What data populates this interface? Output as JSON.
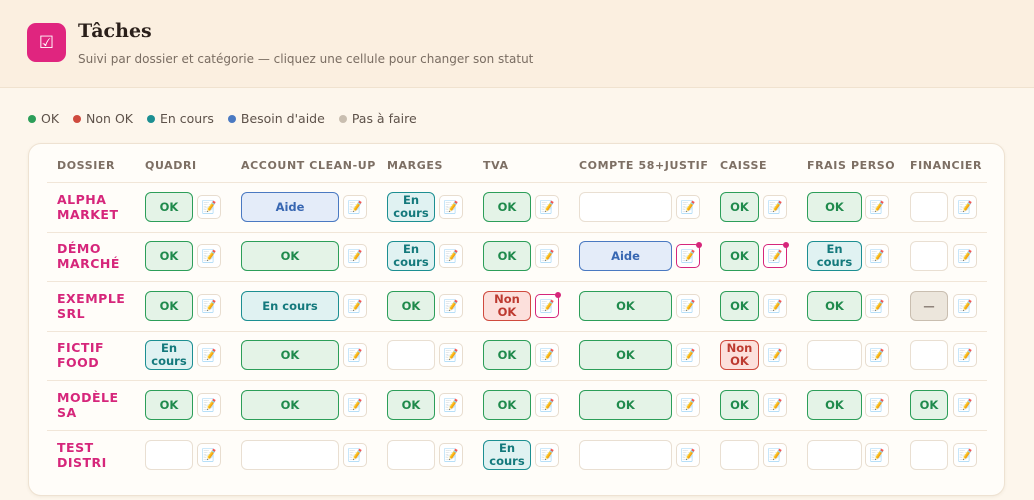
{
  "header": {
    "icon": "checkbox-icon",
    "icon_glyph": "☑",
    "title": "Tâches",
    "subtitle": "Suivi par dossier et catégorie — cliquez une cellule pour changer son statut"
  },
  "legend": [
    {
      "label": "OK",
      "color": "#2c9e59"
    },
    {
      "label": "Non OK",
      "color": "#cf4a3e"
    },
    {
      "label": "En cours",
      "color": "#1c8f92"
    },
    {
      "label": "Besoin d'aide",
      "color": "#4a79c2"
    },
    {
      "label": "Pas à faire",
      "color": "#c9beb0"
    }
  ],
  "columns": [
    "DOSSIER",
    "QUADRI",
    "ACCOUNT CLEAN-UP",
    "MARGES",
    "TVA",
    "COMPTE 58+JUSTIF",
    "CAISSE",
    "FRAIS PERSO",
    "FINANCIER"
  ],
  "status_labels": {
    "ok": "OK",
    "nonok": "Non OK",
    "encours": "En cours",
    "aide": "Aide",
    "na": "—",
    "empty": ""
  },
  "note_icon": "📝",
  "rows": [
    {
      "dossier": "ALPHA MARKET",
      "cells": [
        {
          "status": "ok",
          "label": "OK",
          "note": false
        },
        {
          "status": "aide",
          "label": "Aide",
          "note": false
        },
        {
          "status": "encours",
          "label": "En cours",
          "note": false
        },
        {
          "status": "ok",
          "label": "OK",
          "note": false
        },
        {
          "status": "empty",
          "label": "",
          "note": false
        },
        {
          "status": "ok",
          "label": "OK",
          "note": false
        },
        {
          "status": "ok",
          "label": "OK",
          "note": false
        },
        {
          "status": "empty",
          "label": "",
          "note": false
        }
      ]
    },
    {
      "dossier": "DÉMO MARCHÉ",
      "cells": [
        {
          "status": "ok",
          "label": "OK",
          "note": false
        },
        {
          "status": "ok",
          "label": "OK",
          "note": false
        },
        {
          "status": "encours",
          "label": "En cours",
          "note": false
        },
        {
          "status": "ok",
          "label": "OK",
          "note": false
        },
        {
          "status": "aide",
          "label": "Aide",
          "note": true
        },
        {
          "status": "ok",
          "label": "OK",
          "note": true
        },
        {
          "status": "encours",
          "label": "En cours",
          "note": false
        },
        {
          "status": "empty",
          "label": "",
          "note": false
        }
      ]
    },
    {
      "dossier": "EXEMPLE SRL",
      "cells": [
        {
          "status": "ok",
          "label": "OK",
          "note": false
        },
        {
          "status": "encours",
          "label": "En cours",
          "note": false
        },
        {
          "status": "ok",
          "label": "OK",
          "note": false
        },
        {
          "status": "nonok",
          "label": "Non OK",
          "note": true
        },
        {
          "status": "ok",
          "label": "OK",
          "note": false
        },
        {
          "status": "ok",
          "label": "OK",
          "note": false
        },
        {
          "status": "ok",
          "label": "OK",
          "note": false
        },
        {
          "status": "na",
          "label": "—",
          "note": false
        }
      ]
    },
    {
      "dossier": "FICTIF FOOD",
      "cells": [
        {
          "status": "encours",
          "label": "En cours",
          "note": false
        },
        {
          "status": "ok",
          "label": "OK",
          "note": false
        },
        {
          "status": "empty",
          "label": "",
          "note": false
        },
        {
          "status": "ok",
          "label": "OK",
          "note": false
        },
        {
          "status": "ok",
          "label": "OK",
          "note": false
        },
        {
          "status": "nonok",
          "label": "Non OK",
          "note": false
        },
        {
          "status": "empty",
          "label": "",
          "note": false
        },
        {
          "status": "empty",
          "label": "",
          "note": false
        }
      ]
    },
    {
      "dossier": "MODÈLE SA",
      "cells": [
        {
          "status": "ok",
          "label": "OK",
          "note": false
        },
        {
          "status": "ok",
          "label": "OK",
          "note": false
        },
        {
          "status": "ok",
          "label": "OK",
          "note": false
        },
        {
          "status": "ok",
          "label": "OK",
          "note": false
        },
        {
          "status": "ok",
          "label": "OK",
          "note": false
        },
        {
          "status": "ok",
          "label": "OK",
          "note": false
        },
        {
          "status": "ok",
          "label": "OK",
          "note": false
        },
        {
          "status": "ok",
          "label": "OK",
          "note": false
        }
      ]
    },
    {
      "dossier": "TEST DISTRI",
      "cells": [
        {
          "status": "empty",
          "label": "",
          "note": false
        },
        {
          "status": "empty",
          "label": "",
          "note": false
        },
        {
          "status": "empty",
          "label": "",
          "note": false
        },
        {
          "status": "encours",
          "label": "En cours",
          "note": false
        },
        {
          "status": "empty",
          "label": "",
          "note": false
        },
        {
          "status": "empty",
          "label": "",
          "note": false
        },
        {
          "status": "empty",
          "label": "",
          "note": false
        },
        {
          "status": "empty",
          "label": "",
          "note": false
        }
      ]
    }
  ]
}
